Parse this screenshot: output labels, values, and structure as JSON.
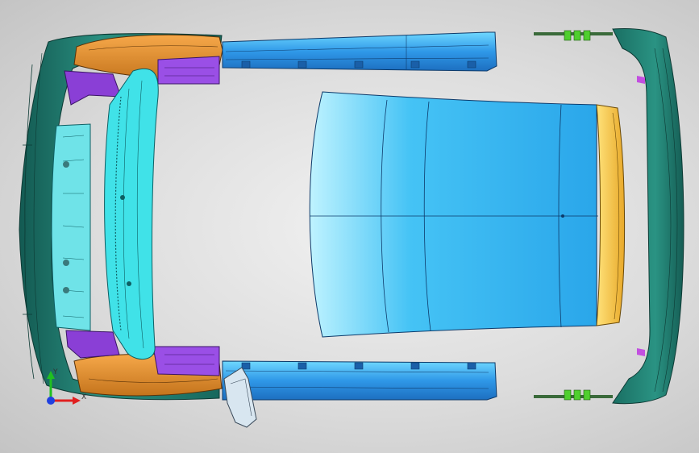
{
  "viewport": {
    "background_center": "#f2f2f2",
    "background_edge": "#c4c4c4",
    "edge_color": "#1a1a1a"
  },
  "parts": [
    {
      "name": "front-bumper",
      "color": "#1f7d70"
    },
    {
      "name": "fender",
      "color": "#e8912a"
    },
    {
      "name": "inner-panel",
      "color": "#8a3fd6"
    },
    {
      "name": "front-frame",
      "color": "#38e0e6"
    },
    {
      "name": "side-sill",
      "color": "#3aa0ea"
    },
    {
      "name": "roof-panel",
      "color": "#36b8f2"
    },
    {
      "name": "rear-header",
      "color": "#f2c23a"
    },
    {
      "name": "rear-bumper",
      "color": "#1f7d70"
    },
    {
      "name": "clips",
      "color": "#4fcf2e"
    }
  ],
  "triad": {
    "x_label": "X",
    "y_label": "Y",
    "x_color": "#e02020",
    "y_color": "#20c020",
    "z_color": "#2040e0"
  }
}
